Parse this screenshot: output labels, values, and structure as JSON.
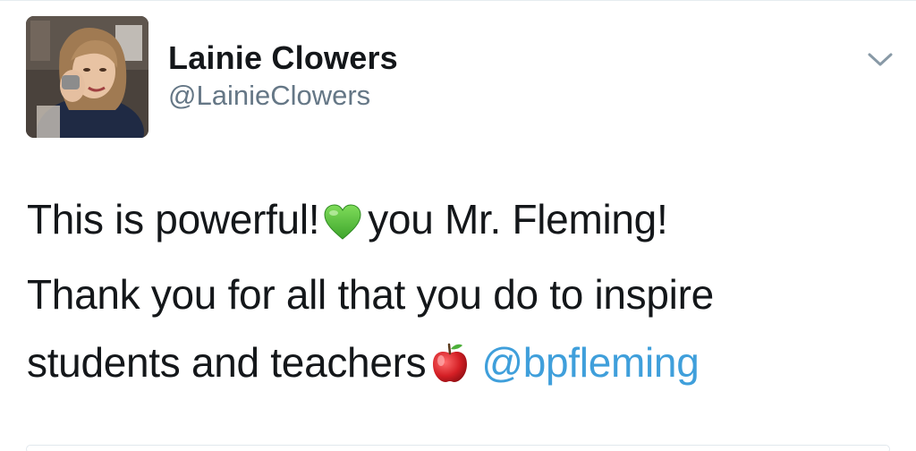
{
  "tweet": {
    "author": {
      "display_name": "Lainie Clowers",
      "handle": "@LainieClowers",
      "avatar_icon": "profile-photo"
    },
    "menu_icon": "chevron-down-icon",
    "body": {
      "line1_before": "This is powerful!",
      "line1_emoji": "green-heart-emoji",
      "line1_after": "you Mr. Fleming!",
      "line2": "Thank you for all that you do to inspire",
      "line3_before": "students and teachers",
      "line3_emoji": "red-apple-emoji",
      "mention": "@bpfleming"
    },
    "colors": {
      "text": "#14171a",
      "handle": "#657786",
      "mention": "#3f9fdb",
      "divider": "#e6ecf0"
    }
  }
}
